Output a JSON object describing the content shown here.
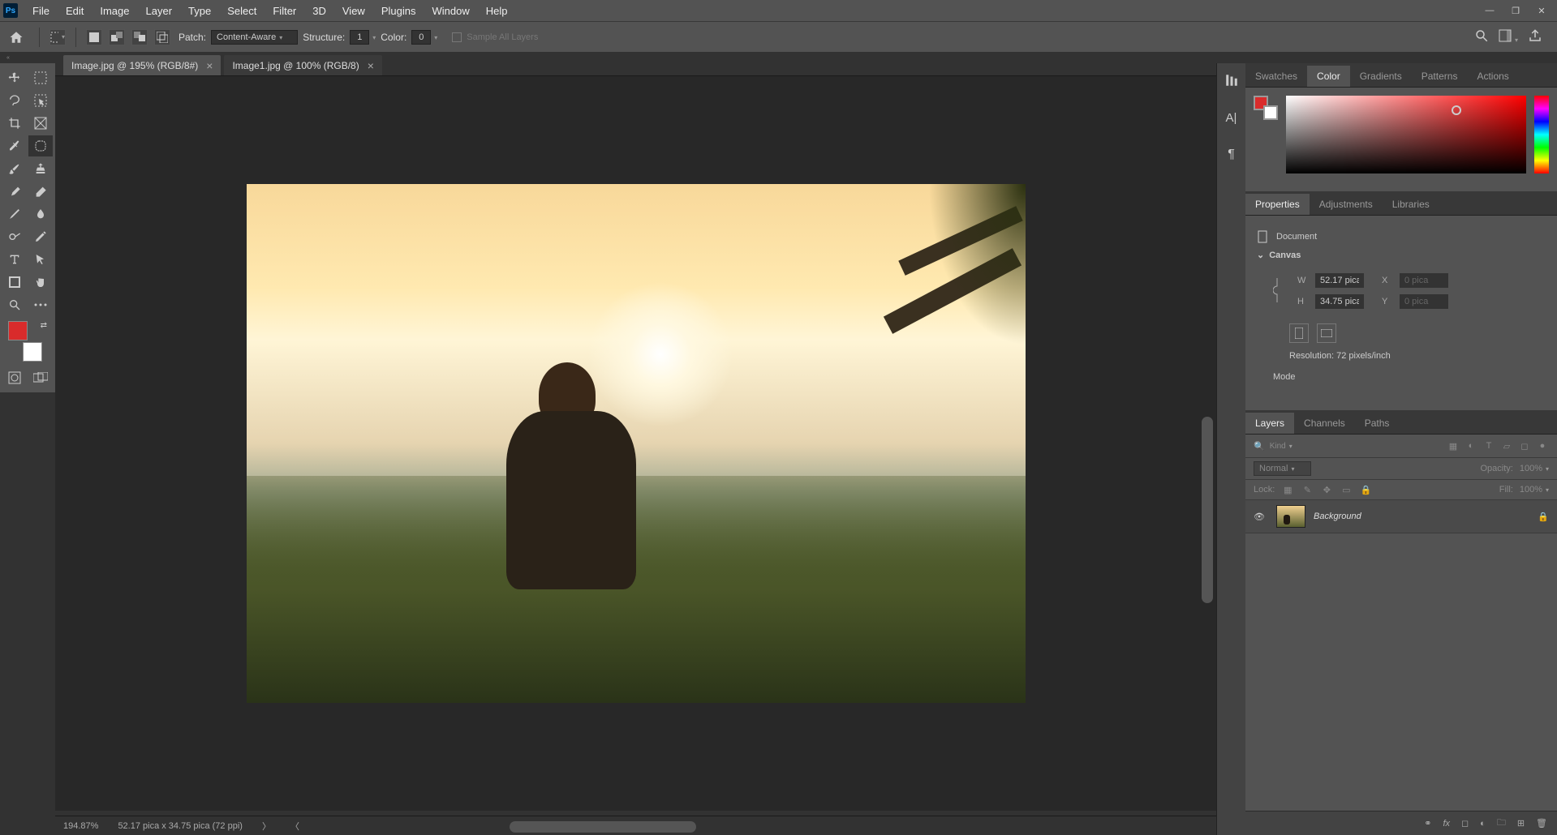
{
  "menu": [
    "File",
    "Edit",
    "Image",
    "Layer",
    "Type",
    "Select",
    "Filter",
    "3D",
    "View",
    "Plugins",
    "Window",
    "Help"
  ],
  "optionsbar": {
    "patch_label": "Patch:",
    "patch_mode": "Content-Aware",
    "structure_label": "Structure:",
    "structure_val": "1",
    "color_label": "Color:",
    "color_val": "0",
    "sample_all": "Sample All Layers"
  },
  "tabs": [
    {
      "label": "Image.jpg @ 195% (RGB/8#)",
      "active": true
    },
    {
      "label": "Image1.jpg @ 100% (RGB/8)",
      "active": false
    }
  ],
  "status": {
    "zoom": "194.87%",
    "dims": "52.17 pica x 34.75 pica (72 ppi)"
  },
  "color_panel": {
    "tabs": [
      "Swatches",
      "Color",
      "Gradients",
      "Patterns",
      "Actions"
    ],
    "active": "Color"
  },
  "props_panel": {
    "tabs": [
      "Properties",
      "Adjustments",
      "Libraries"
    ],
    "active": "Properties",
    "doc_label": "Document",
    "section": "Canvas",
    "W": "52.17 pica",
    "H": "34.75 pica",
    "X": "0 pica",
    "Y": "0 pica",
    "res": "Resolution: 72 pixels/inch",
    "mode": "Mode"
  },
  "layers_panel": {
    "tabs": [
      "Layers",
      "Channels",
      "Paths"
    ],
    "active": "Layers",
    "filter_kind": "Kind",
    "blend": "Normal",
    "opacity_label": "Opacity:",
    "opacity_val": "100%",
    "lock_label": "Lock:",
    "fill_label": "Fill:",
    "fill_val": "100%",
    "layer_name": "Background"
  },
  "colors": {
    "fg": "#d92b2b",
    "bg": "#ffffff"
  }
}
